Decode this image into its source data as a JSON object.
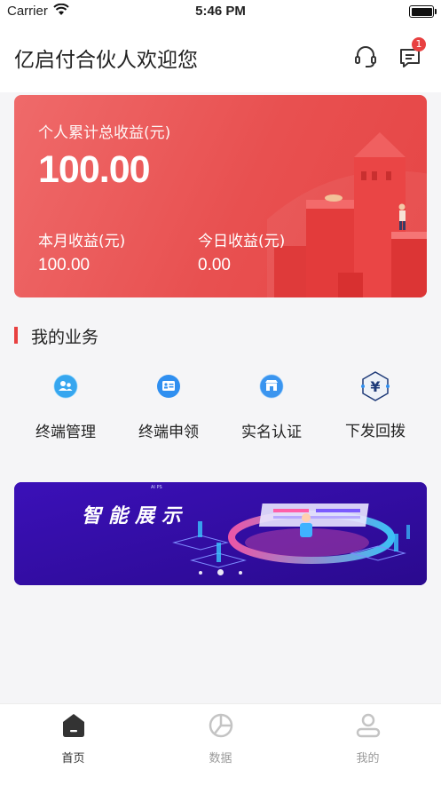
{
  "status_bar": {
    "carrier": "Carrier",
    "time": "5:46 PM"
  },
  "header": {
    "title": "亿启付合伙人欢迎您",
    "message_badge": "1",
    "icons": [
      "headset-icon",
      "message-icon"
    ]
  },
  "earnings_card": {
    "total_label": "个人累计总收益(元)",
    "total_value": "100.00",
    "month_label": "本月收益(元)",
    "month_value": "100.00",
    "today_label": "今日收益(元)",
    "today_value": "0.00"
  },
  "business": {
    "section_title": "我的业务",
    "items": [
      {
        "label": "终端管理",
        "icon": "users-icon"
      },
      {
        "label": "终端申领",
        "icon": "id-card-icon"
      },
      {
        "label": "实名认证",
        "icon": "shop-icon"
      },
      {
        "label": "下发回拨",
        "icon": "yuan-icon"
      }
    ]
  },
  "banner": {
    "title": "智能展示",
    "tag": "AI PS",
    "slides_count": 3,
    "active_slide": 2
  },
  "tab_bar": {
    "tabs": [
      {
        "label": "首页",
        "icon": "home-icon",
        "active": true
      },
      {
        "label": "数据",
        "icon": "pie-chart-icon",
        "active": false
      },
      {
        "label": "我的",
        "icon": "profile-icon",
        "active": false
      }
    ]
  },
  "colors": {
    "accent_red": "#e84040",
    "card_red": "#e85050",
    "banner_purple": "#3a0fb0",
    "icon_blue": "#2f8ff0"
  }
}
